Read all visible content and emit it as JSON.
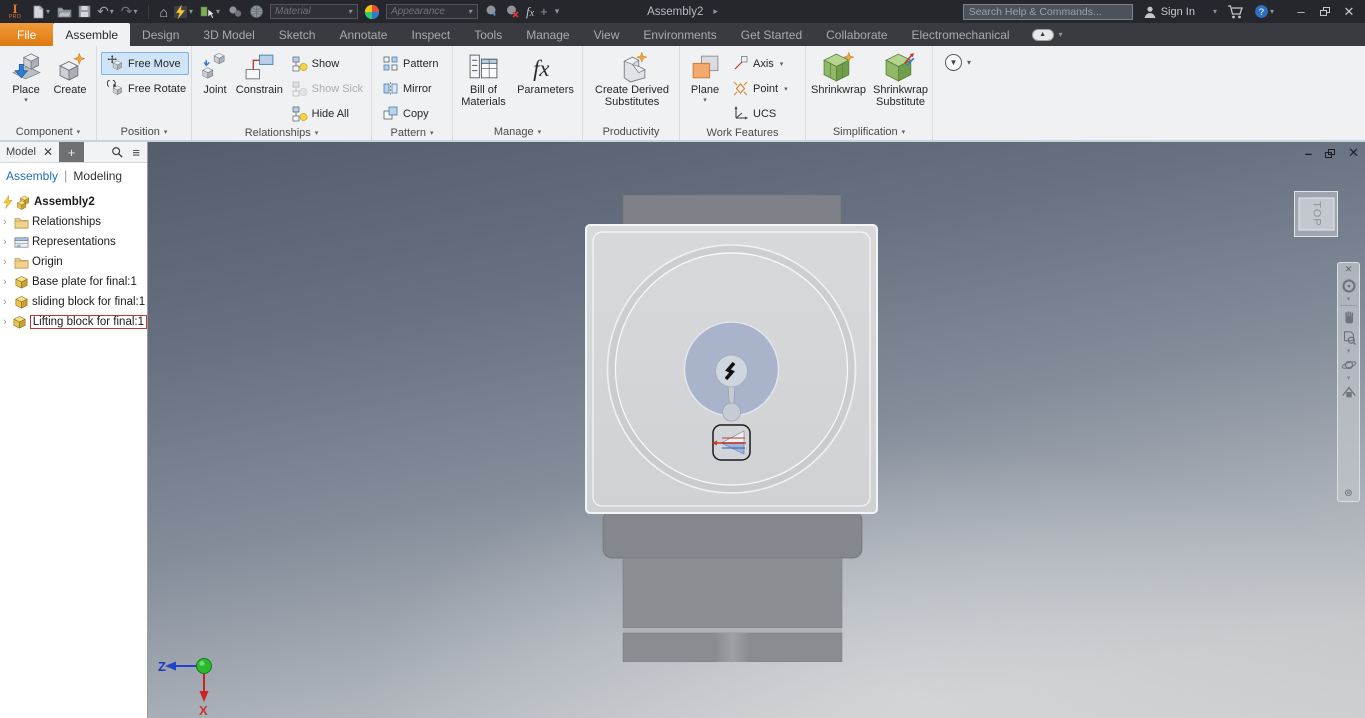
{
  "titlebar": {
    "logo_letter": "I",
    "logo_sub": "PRO",
    "material_value": "Material",
    "appearance_value": "Appearance",
    "document_title": "Assembly2",
    "search_placeholder": "Search Help & Commands...",
    "sign_in_label": "Sign In"
  },
  "tabs": [
    {
      "label": "File"
    },
    {
      "label": "Assemble"
    },
    {
      "label": "Design"
    },
    {
      "label": "3D Model"
    },
    {
      "label": "Sketch"
    },
    {
      "label": "Annotate"
    },
    {
      "label": "Inspect"
    },
    {
      "label": "Tools"
    },
    {
      "label": "Manage"
    },
    {
      "label": "View"
    },
    {
      "label": "Environments"
    },
    {
      "label": "Get Started"
    },
    {
      "label": "Collaborate"
    },
    {
      "label": "Electromechanical"
    }
  ],
  "ribbon": {
    "panels": [
      {
        "label": "Component",
        "buttons": [
          {
            "label": "Place"
          },
          {
            "label": "Create"
          }
        ]
      },
      {
        "label": "Position",
        "buttons": [
          {
            "label": "Free Move"
          },
          {
            "label": "Free Rotate"
          }
        ]
      },
      {
        "label": "Relationships",
        "buttons": [
          {
            "label": "Joint"
          },
          {
            "label": "Constrain"
          },
          {
            "label": "Show"
          },
          {
            "label": "Show Sick"
          },
          {
            "label": "Hide All"
          }
        ]
      },
      {
        "label": "Pattern",
        "buttons": [
          {
            "label": "Pattern"
          },
          {
            "label": "Mirror"
          },
          {
            "label": "Copy"
          }
        ]
      },
      {
        "label": "Manage",
        "buttons": [
          {
            "label": "Bill of Materials"
          },
          {
            "label": "Parameters"
          }
        ]
      },
      {
        "label": "Productivity",
        "buttons": [
          {
            "label": "Create Derived Substitutes"
          }
        ]
      },
      {
        "label": "Work Features",
        "buttons": [
          {
            "label": "Plane"
          },
          {
            "label": "Axis"
          },
          {
            "label": "Point"
          },
          {
            "label": "UCS"
          }
        ]
      },
      {
        "label": "Simplification",
        "buttons": [
          {
            "label": "Shrinkwrap"
          },
          {
            "label": "Shrinkwrap Substitute"
          }
        ]
      }
    ]
  },
  "browser": {
    "panel_tab": "Model",
    "mode_assembly": "Assembly",
    "mode_modeling": "Modeling",
    "tree": [
      {
        "label": "Assembly2"
      },
      {
        "label": "Relationships"
      },
      {
        "label": "Representations"
      },
      {
        "label": "Origin"
      },
      {
        "label": "Base plate for final:1"
      },
      {
        "label": "sliding block for final:1"
      },
      {
        "label": "Lifting block for final:1"
      }
    ]
  },
  "viewport": {
    "viewcube_face": "TOP",
    "axis_z": "Z",
    "axis_x": "X"
  },
  "colors": {
    "accent_orange": "#ec8b2d",
    "active_tool_blue": "#cfe4f7",
    "tree_selection_red": "#c0392b",
    "part_hole_blue": "#a9b3ca",
    "viewport_top": "#545d6b",
    "viewport_bottom": "#cbced1"
  }
}
